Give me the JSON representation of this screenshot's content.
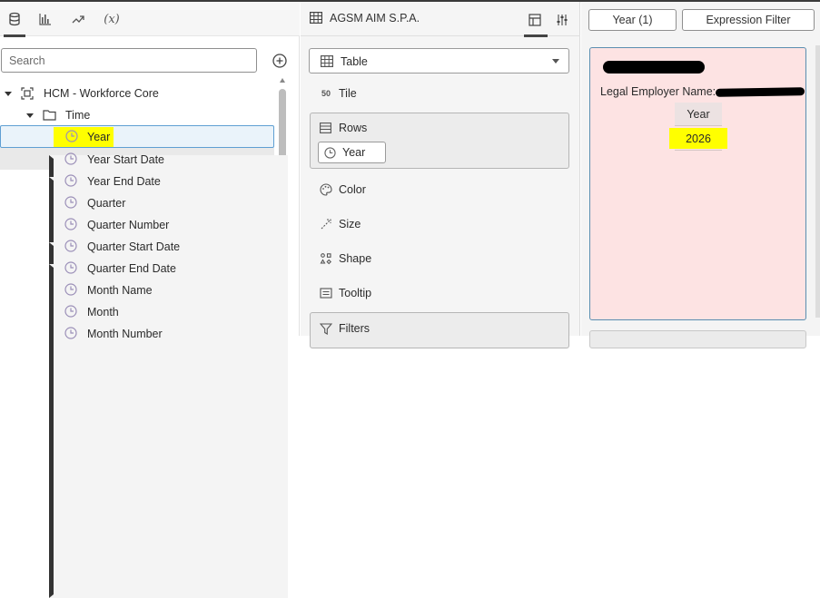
{
  "left_panel": {
    "tabs": [
      {
        "name": "data",
        "icon": "database-icon"
      },
      {
        "name": "visualizations",
        "icon": "bar-chart-icon"
      },
      {
        "name": "analytics",
        "icon": "trend-icon"
      },
      {
        "name": "calculations",
        "label": "(x)"
      }
    ],
    "search": {
      "placeholder": "Search",
      "value": ""
    },
    "tree": {
      "root": "HCM - Workforce Core",
      "folder": "Time",
      "items": [
        {
          "label": "Year",
          "selected": true,
          "expandable": false
        },
        {
          "label": "Year Start Date",
          "expandable": true
        },
        {
          "label": "Year End Date",
          "expandable": true
        },
        {
          "label": "Quarter",
          "expandable": false
        },
        {
          "label": "Quarter Number",
          "expandable": false
        },
        {
          "label": "Quarter Start Date",
          "expandable": true
        },
        {
          "label": "Quarter End Date",
          "expandable": true
        },
        {
          "label": "Month Name",
          "expandable": false
        },
        {
          "label": "Month",
          "expandable": false
        },
        {
          "label": "Month Number",
          "expandable": false
        }
      ]
    }
  },
  "middle_panel": {
    "title": "AGSM AIM S.P.A.",
    "viz_type": "Table",
    "grammar": {
      "tile": "Tile",
      "rows": "Rows",
      "rows_item": "Year",
      "color": "Color",
      "size": "Size",
      "shape": "Shape",
      "tooltip": "Tooltip",
      "filters": "Filters"
    }
  },
  "right_panel": {
    "filter_year": "Year (1)",
    "filter_expression": "Expression Filter",
    "card": {
      "legal_employer_label": "Legal Employer Name:",
      "column_header": "Year",
      "value": "2026"
    }
  },
  "colors": {
    "highlight": "#ffff00",
    "card_background": "#fde3e3",
    "selection_border": "#5f9fd3"
  }
}
